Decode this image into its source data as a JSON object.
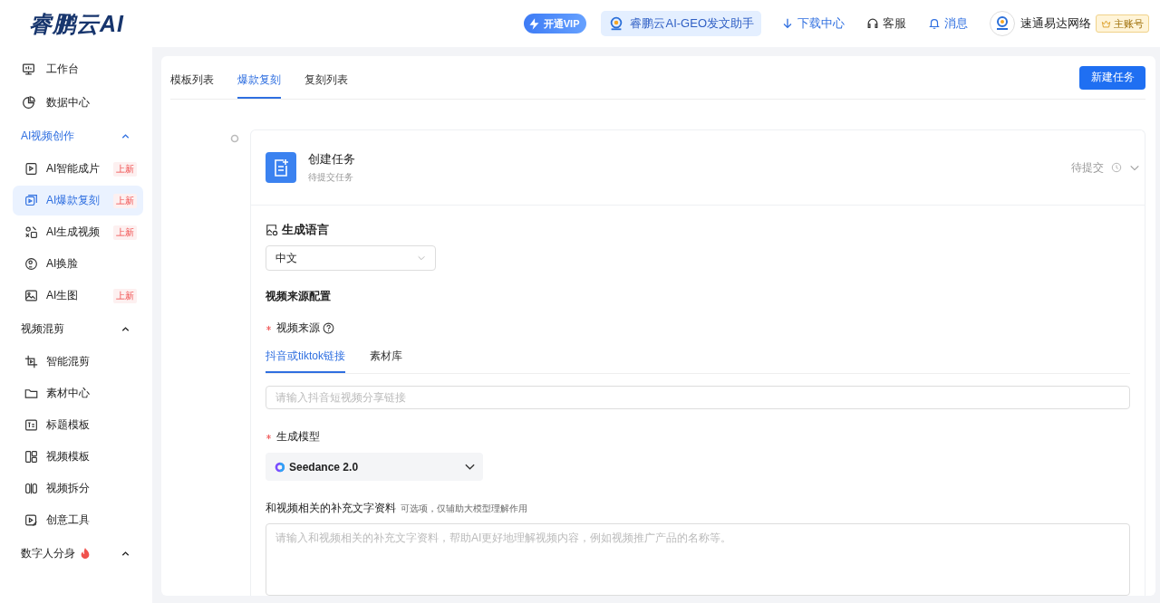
{
  "header": {
    "logo": "睿鹏云AI",
    "vip": "开通VIP",
    "geo": "睿鹏云AI-GEO发文助手",
    "download": "下载中心",
    "service": "客服",
    "messages": "消息",
    "account": "速通易达网络",
    "account_badge": "主账号"
  },
  "sidebar": [
    {
      "kind": "item",
      "label": "工作台"
    },
    {
      "kind": "item",
      "label": "数据中心"
    },
    {
      "kind": "group",
      "label": "AI视频创作",
      "expanded": true,
      "hot": false,
      "children": [
        {
          "label": "AI智能成片",
          "badge": "上新",
          "selected": false
        },
        {
          "label": "AI爆款复刻",
          "badge": "上新",
          "selected": true
        },
        {
          "label": "AI生成视频",
          "badge": "上新",
          "selected": false
        },
        {
          "label": "AI换脸",
          "selected": false
        },
        {
          "label": "AI生图",
          "badge": "上新",
          "selected": false
        }
      ]
    },
    {
      "kind": "group",
      "label": "视频混剪",
      "expanded": true,
      "hot": false,
      "children": [
        {
          "label": "智能混剪",
          "selected": false
        },
        {
          "label": "素材中心",
          "selected": false
        },
        {
          "label": "标题模板",
          "selected": false
        },
        {
          "label": "视频模板",
          "selected": false
        },
        {
          "label": "视频拆分",
          "selected": false
        },
        {
          "label": "创意工具",
          "selected": false
        }
      ]
    },
    {
      "kind": "group",
      "label": "数字人分身",
      "expanded": true,
      "hot": true
    }
  ],
  "tabs": [
    {
      "label": "模板列表",
      "selected": false
    },
    {
      "label": "爆款复刻",
      "selected": true
    },
    {
      "label": "复刻列表",
      "selected": false
    }
  ],
  "new_task_button": "新建任务",
  "task": {
    "title": "创建任务",
    "subtitle": "待提交任务",
    "status": "待提交",
    "expanded": true,
    "language": {
      "label": "生成语言",
      "value": "中文"
    },
    "source_section": "视频来源配置",
    "source": {
      "label": "视频来源",
      "required": true,
      "tabs": [
        {
          "label": "抖音或tiktok链接",
          "selected": true
        },
        {
          "label": "素材库",
          "selected": false
        }
      ],
      "placeholder": "请输入抖音短视频分享链接"
    },
    "model": {
      "label": "生成模型",
      "required": true,
      "value": "Seedance 2.0"
    },
    "notes": {
      "label": "和视频相关的补充文字资料",
      "hint": "可选项，仅辅助大模型理解作用",
      "placeholder": "请输入和视频相关的补充文字资料，帮助AI更好地理解视频内容，例如视频推广产品的名称等。"
    }
  }
}
